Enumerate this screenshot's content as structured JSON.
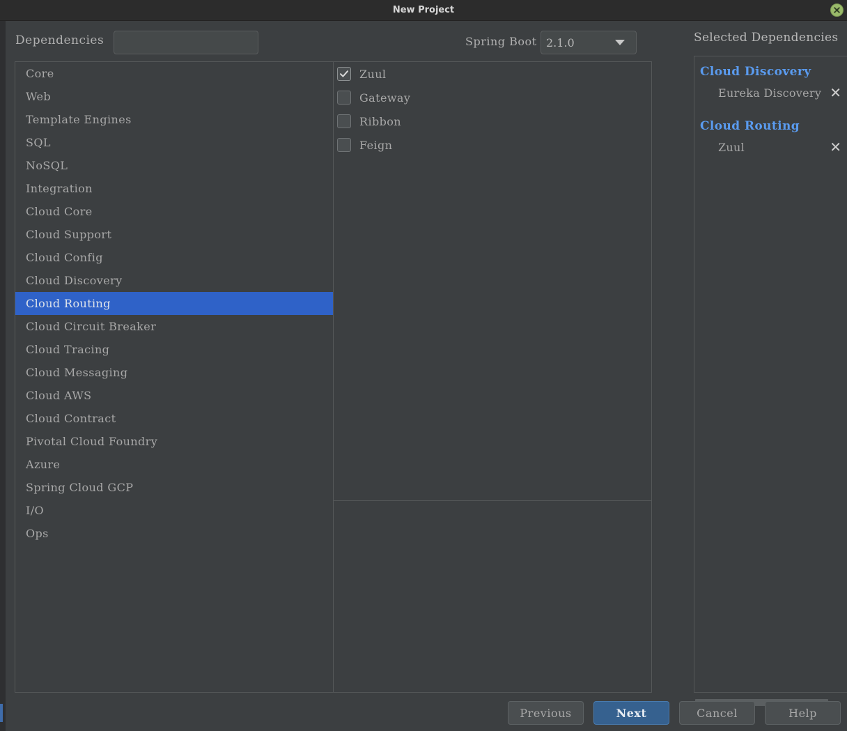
{
  "window": {
    "title": "New Project",
    "close_icon": "close-icon"
  },
  "toolbar": {
    "dependencies_label": "Dependencies",
    "search": {
      "icon": "search-icon",
      "value": "",
      "placeholder": ""
    },
    "spring_boot_label": "Spring Boot",
    "spring_boot_version": "2.1.0",
    "selected_dependencies_label": "Selected Dependencies"
  },
  "categories": [
    {
      "label": "Core",
      "selected": false
    },
    {
      "label": "Web",
      "selected": false
    },
    {
      "label": "Template Engines",
      "selected": false
    },
    {
      "label": "SQL",
      "selected": false
    },
    {
      "label": "NoSQL",
      "selected": false
    },
    {
      "label": "Integration",
      "selected": false
    },
    {
      "label": "Cloud Core",
      "selected": false
    },
    {
      "label": "Cloud Support",
      "selected": false
    },
    {
      "label": "Cloud Config",
      "selected": false
    },
    {
      "label": "Cloud Discovery",
      "selected": false
    },
    {
      "label": "Cloud Routing",
      "selected": true
    },
    {
      "label": "Cloud Circuit Breaker",
      "selected": false
    },
    {
      "label": "Cloud Tracing",
      "selected": false
    },
    {
      "label": "Cloud Messaging",
      "selected": false
    },
    {
      "label": "Cloud AWS",
      "selected": false
    },
    {
      "label": "Cloud Contract",
      "selected": false
    },
    {
      "label": "Pivotal Cloud Foundry",
      "selected": false
    },
    {
      "label": "Azure",
      "selected": false
    },
    {
      "label": "Spring Cloud GCP",
      "selected": false
    },
    {
      "label": "I/O",
      "selected": false
    },
    {
      "label": "Ops",
      "selected": false
    }
  ],
  "modules": [
    {
      "label": "Zuul",
      "checked": true
    },
    {
      "label": "Gateway",
      "checked": false
    },
    {
      "label": "Ribbon",
      "checked": false
    },
    {
      "label": "Feign",
      "checked": false
    }
  ],
  "selected_dependencies": [
    {
      "group": "Cloud Discovery",
      "items": [
        {
          "label": "Eureka Discovery",
          "remove_icon": "close-icon"
        }
      ]
    },
    {
      "group": "Cloud Routing",
      "items": [
        {
          "label": "Zuul",
          "remove_icon": "close-icon"
        }
      ]
    }
  ],
  "buttons": {
    "previous": "Previous",
    "next": "Next",
    "cancel": "Cancel",
    "help": "Help"
  },
  "colors": {
    "selection_blue": "#2f62c8",
    "primary_button": "#36618f",
    "group_header_blue": "#5a9bef",
    "window_background": "#3c3f41",
    "titlebar_background": "#2c2c2c",
    "close_button_green": "#9aba6a"
  }
}
